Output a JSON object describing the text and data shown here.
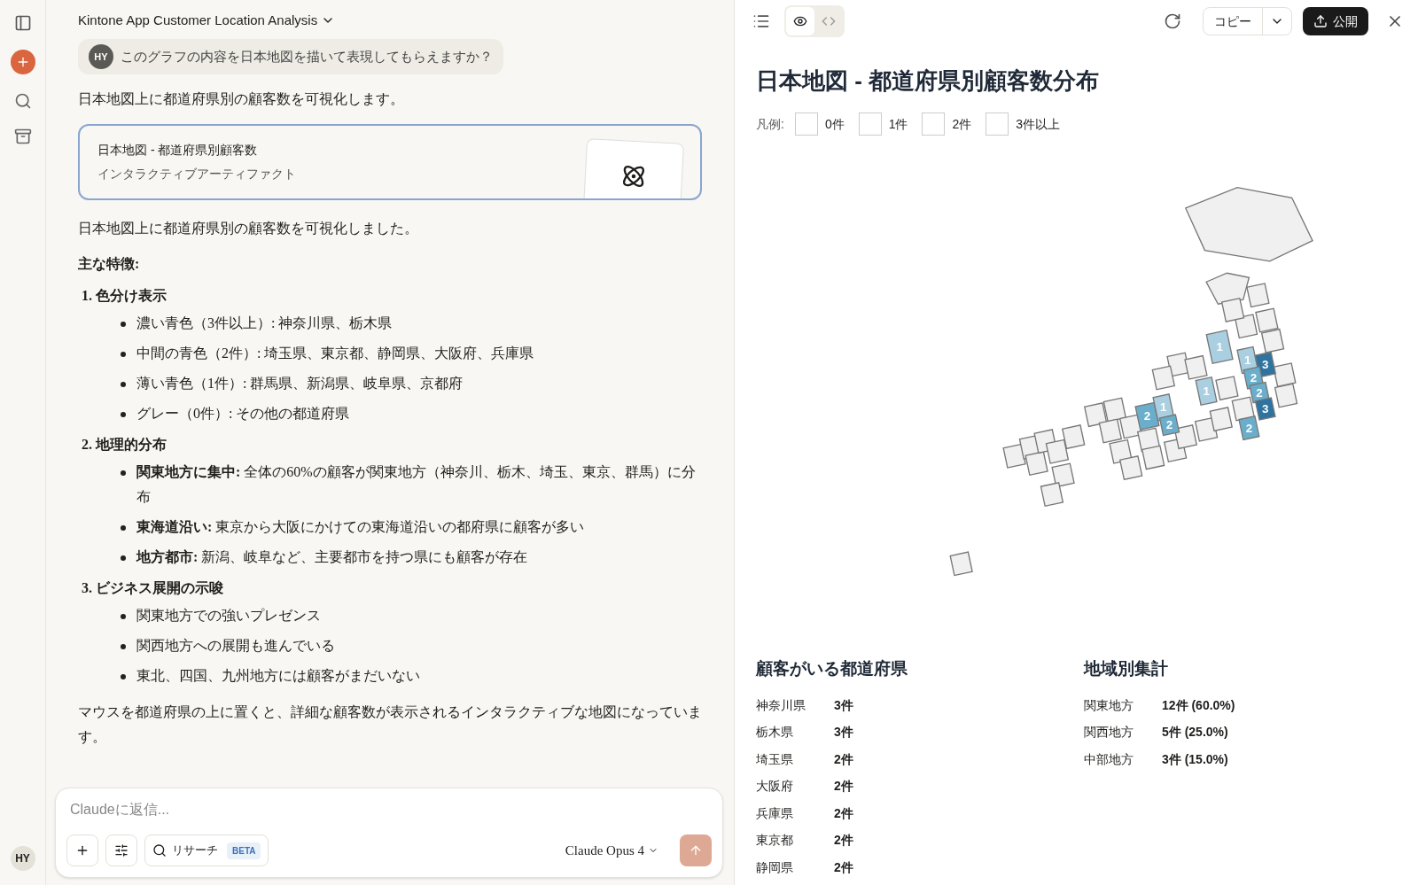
{
  "sidebar": {
    "avatar": "HY"
  },
  "chat": {
    "title": "Kintone App Customer Location Analysis",
    "user_message": {
      "avatar": "HY",
      "text": "このグラフの内容を日本地図を描いて表現してもらえますか？"
    },
    "intro": "日本地図上に都道府県別の顧客数を可視化します。",
    "artifact": {
      "title": "日本地図 - 都道府県別顧客数",
      "subtitle": "インタラクティブアーティファクト"
    },
    "summary": "日本地図上に都道府県別の顧客数を可視化しました。",
    "features_heading": "主な特徴:",
    "sections": [
      {
        "number": "1.",
        "title": "色分け表示",
        "items": [
          "濃い青色（3件以上）: 神奈川県、栃木県",
          "中間の青色（2件）: 埼玉県、東京都、静岡県、大阪府、兵庫県",
          "薄い青色（1件）: 群馬県、新潟県、岐阜県、京都府",
          "グレー（0件）: その他の都道府県"
        ]
      },
      {
        "number": "2.",
        "title": "地理的分布",
        "items": [
          "**関東地方に集中:** 全体の60%の顧客が関東地方（神奈川、栃木、埼玉、東京、群馬）に分布",
          "**東海道沿い:** 東京から大阪にかけての東海道沿いの都府県に顧客が多い",
          "**地方都市:** 新潟、岐阜など、主要都市を持つ県にも顧客が存在"
        ]
      },
      {
        "number": "3.",
        "title": "ビジネス展開の示唆",
        "items": [
          "関東地方での強いプレゼンス",
          "関西地方への展開も進んでいる",
          "東北、四国、九州地方には顧客がまだいない"
        ]
      }
    ],
    "closing": "マウスを都道府県の上に置くと、詳細な顧客数が表示されるインタラクティブな地図になっています。",
    "composer": {
      "placeholder": "Claudeに返信...",
      "research": "リサーチ",
      "beta": "BETA",
      "model": "Claude Opus 4"
    }
  },
  "artifact_panel": {
    "views": [
      {
        "kind": "preview",
        "selected": true
      },
      {
        "kind": "code",
        "selected": false
      }
    ],
    "copy": "コピー",
    "publish": "公開",
    "title": "日本地図 - 都道府県別顧客数分布",
    "legend_label": "凡例:",
    "legend": [
      "0件",
      "1件",
      "2件",
      "3件以上"
    ],
    "map_tiles": [
      {
        "count": "1",
        "kind": "light"
      },
      {
        "count": "1",
        "kind": "light"
      },
      {
        "count": "3",
        "kind": "dark"
      },
      {
        "count": "2",
        "kind": "mid"
      },
      {
        "count": "2",
        "kind": "mid"
      },
      {
        "count": "3",
        "kind": "dark"
      },
      {
        "count": "1",
        "kind": "light"
      },
      {
        "count": "2",
        "kind": "mid"
      },
      {
        "count": "2",
        "kind": "mid"
      },
      {
        "count": "1",
        "kind": "light"
      },
      {
        "count": "2",
        "kind": "mid"
      }
    ],
    "customers_heading": "顧客がいる都道府県",
    "customers": [
      {
        "name": "神奈川県",
        "count": "3件"
      },
      {
        "name": "栃木県",
        "count": "3件"
      },
      {
        "name": "埼玉県",
        "count": "2件"
      },
      {
        "name": "大阪府",
        "count": "2件"
      },
      {
        "name": "兵庫県",
        "count": "2件"
      },
      {
        "name": "東京都",
        "count": "2件"
      },
      {
        "name": "静岡県",
        "count": "2件"
      }
    ],
    "regions_heading": "地域別集計",
    "regions": [
      {
        "name": "関東地方",
        "value": "12件 (60.0%)"
      },
      {
        "name": "関西地方",
        "value": "5件 (25.0%)"
      },
      {
        "name": "中部地方",
        "value": "3件 (15.0%)"
      }
    ]
  }
}
